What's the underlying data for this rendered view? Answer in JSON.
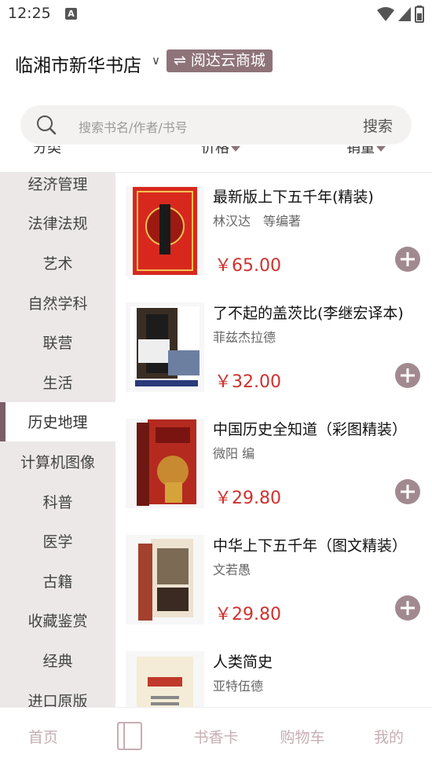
{
  "status": {
    "time": "12:25",
    "notif": "A"
  },
  "header": {
    "store_name": "临湘市新华书店",
    "switch_icon": "⇌",
    "badge": "阅达云商城"
  },
  "search": {
    "placeholder": "搜索书名/作者/书号",
    "button": "搜索"
  },
  "sort": {
    "items": [
      "分类",
      "价格",
      "销量"
    ]
  },
  "sidebar": {
    "items": [
      "经济管理",
      "法律法规",
      "艺术",
      "自然学科",
      "联营",
      "生活",
      "历史地理",
      "计算机图像",
      "科普",
      "医学",
      "古籍",
      "收藏鉴赏",
      "经典",
      "进口原版"
    ],
    "active": "历史地理"
  },
  "products": [
    {
      "title": "最新版上下五千年(精装)",
      "author": "林汉达　等编著",
      "price": "￥65.00"
    },
    {
      "title": "了不起的盖茨比(李继宏译本)",
      "author": "菲兹杰拉德",
      "price": "￥32.00"
    },
    {
      "title": "中国历史全知道（彩图精装）",
      "author": "微阳 编",
      "price": "￥29.80"
    },
    {
      "title": "中华上下五千年（图文精装）",
      "author": "文若愚",
      "price": "￥29.80"
    },
    {
      "title": "人类简史",
      "author": "亚特伍德",
      "price": ""
    }
  ],
  "bottom_nav": {
    "home": "首页",
    "shelf_icon": "book-icon",
    "card": "书香卡",
    "cart": "购物车",
    "mine": "我的"
  },
  "colors": {
    "accent": "#8e7479",
    "price": "#d0312d",
    "sidebar_bg": "#ede8e8",
    "nav_inactive": "#c7aeb2"
  }
}
